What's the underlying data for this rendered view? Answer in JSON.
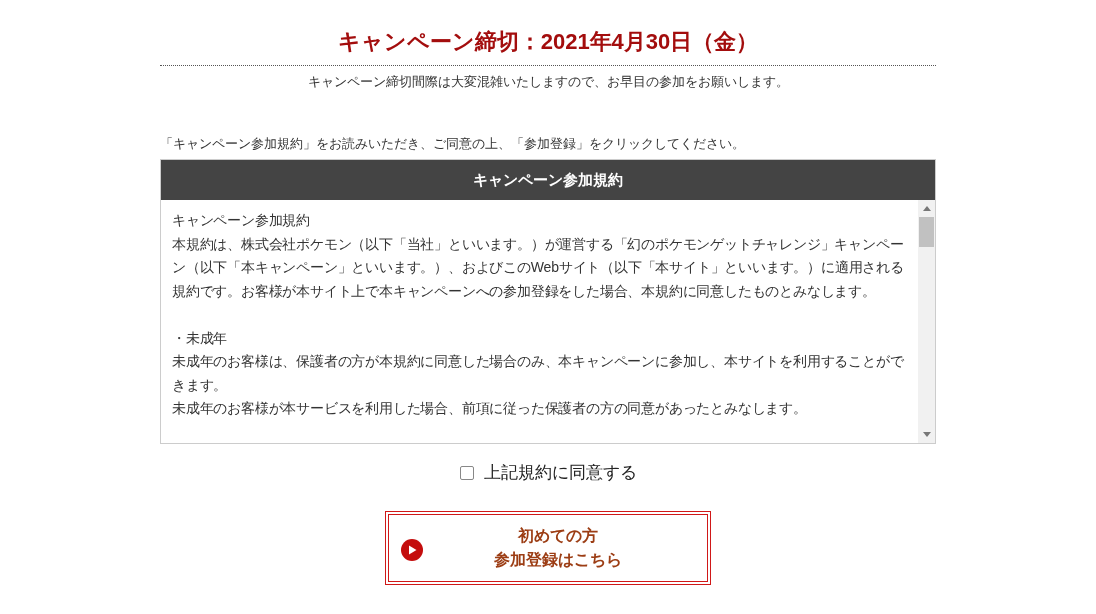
{
  "deadline": {
    "title": "キャンペーン締切：2021年4月30日（金）",
    "note": "キャンペーン締切間際は大変混雑いたしますので、お早目の参加をお願いします。"
  },
  "instruction": "「キャンペーン参加規約」をお読みいただき、ご同意の上、「参加登録」をクリックしてください。",
  "terms": {
    "header": "キャンペーン参加規約",
    "paragraphs": [
      {
        "kind": "line",
        "text": "キャンペーン参加規約"
      },
      {
        "kind": "line",
        "text": "本規約は、株式会社ポケモン（以下「当社」といいます。）が運営する「幻のポケモンゲットチャレンジ」キャンペーン（以下「本キャンペーン」といいます。）、およびこのWebサイト（以下「本サイト」といいます。）に適用される規約です。お客様が本サイト上で本キャンペーンへの参加登録をした場合、本規約に同意したものとみなします。"
      },
      {
        "kind": "gap"
      },
      {
        "kind": "line",
        "text": "・未成年"
      },
      {
        "kind": "line",
        "text": "未成年のお客様は、保護者の方が本規約に同意した場合のみ、本キャンペーンに参加し、本サイトを利用することができます。"
      },
      {
        "kind": "line",
        "text": "未成年のお客様が本サービスを利用した場合、前項に従った保護者の方の同意があったとみなします。"
      }
    ]
  },
  "agree": {
    "label": "上記規約に同意する",
    "checked": false
  },
  "register_button": {
    "lines": [
      "初めての方",
      "参加登録はこちら"
    ]
  }
}
